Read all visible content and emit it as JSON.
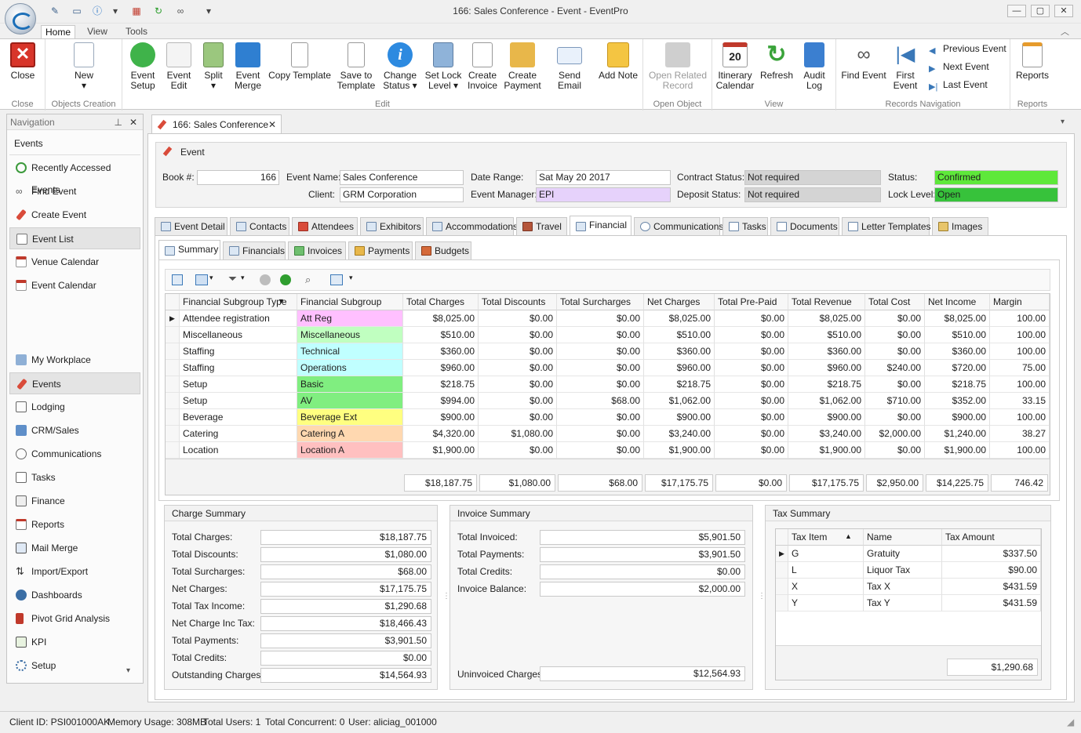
{
  "window": {
    "title": "166: Sales Conference - Event - EventPro"
  },
  "ribbon_tabs": [
    "Home",
    "View",
    "Tools"
  ],
  "ribbon": {
    "close": {
      "label": "Close",
      "group": "Close"
    },
    "objects_creation": {
      "group": "Objects Creation",
      "new_label": "New"
    },
    "edit_group": "Edit",
    "edit_buttons": [
      {
        "label1": "Event",
        "label2": "Setup"
      },
      {
        "label1": "Event",
        "label2": "Edit"
      },
      {
        "label1": "Split",
        "label2": "▾"
      },
      {
        "label1": "Event",
        "label2": "Merge"
      },
      {
        "label1": "Copy Template",
        "label2": ""
      },
      {
        "label1": "Save to",
        "label2": "Template"
      },
      {
        "label1": "Change",
        "label2": "Status ▾"
      },
      {
        "label1": "Set Lock",
        "label2": "Level ▾"
      },
      {
        "label1": "Create",
        "label2": "Invoice"
      },
      {
        "label1": "Create",
        "label2": "Payment"
      },
      {
        "label1": "Send Email",
        "label2": ""
      },
      {
        "label1": "Add Note",
        "label2": ""
      }
    ],
    "open_object": {
      "group": "Open Object",
      "label1": "Open Related",
      "label2": "Record"
    },
    "view_group": "View",
    "view_buttons": [
      {
        "label1": "Itinerary",
        "label2": "Calendar"
      },
      {
        "label1": "Refresh",
        "label2": ""
      },
      {
        "label1": "Audit",
        "label2": "Log"
      }
    ],
    "records_nav": {
      "group": "Records Navigation",
      "find_event": "Find Event",
      "first_event1": "First",
      "first_event2": "Event",
      "previous_event": "Previous Event",
      "next_event": "Next Event",
      "last_event": "Last Event"
    },
    "reports": {
      "group": "Reports",
      "label": "Reports"
    }
  },
  "navigation": {
    "header": "Navigation",
    "section": "Events",
    "top_items": [
      "Recently Accessed Events",
      "Find Event",
      "Create Event",
      "Event List",
      "Venue Calendar",
      "Event Calendar"
    ],
    "modules": [
      "My Workplace",
      "Events",
      "Lodging",
      "CRM/Sales",
      "Communications",
      "Tasks",
      "Finance",
      "Reports",
      "Mail Merge",
      "Import/Export",
      "Dashboards",
      "Pivot Grid Analysis",
      "KPI",
      "Setup"
    ]
  },
  "document_tab": "166: Sales Conference",
  "event": {
    "panel_title": "Event",
    "book_label": "Book #:",
    "book": "166",
    "name_label": "Event Name:",
    "name": "Sales Conference",
    "client_label": "Client:",
    "client": "GRM Corporation",
    "date_label": "Date Range:",
    "date": "Sat May 20 2017",
    "manager_label": "Event Manager:",
    "manager": "EPI",
    "contract_label": "Contract Status:",
    "contract": "Not required",
    "deposit_label": "Deposit Status:",
    "deposit": "Not required",
    "status_label": "Status:",
    "status": "Confirmed",
    "lock_label": "Lock Level:",
    "lock": "Open"
  },
  "main_tabs": [
    "Event Detail",
    "Contacts",
    "Attendees",
    "Exhibitors",
    "Accommodations",
    "Travel",
    "Financial",
    "Communications",
    "Tasks",
    "Documents",
    "Letter Templates",
    "Images"
  ],
  "sub_tabs": [
    "Summary",
    "Financials",
    "Invoices",
    "Payments",
    "Budgets"
  ],
  "grid": {
    "columns": [
      "Financial Subgroup Type",
      "Financial Subgroup",
      "Total Charges",
      "Total Discounts",
      "Total Surcharges",
      "Net Charges",
      "Total Pre-Paid",
      "Total Revenue",
      "Total Cost",
      "Net Income",
      "Margin"
    ],
    "rows": [
      {
        "type": "Attendee registration",
        "subgroup": "Att Reg",
        "color": "#ffc0ff",
        "charges": "$8,025.00",
        "discounts": "$0.00",
        "surcharges": "$0.00",
        "net": "$8,025.00",
        "prepaid": "$0.00",
        "revenue": "$8,025.00",
        "cost": "$0.00",
        "income": "$8,025.00",
        "margin": "100.00"
      },
      {
        "type": "Miscellaneous",
        "subgroup": "Miscellaneous",
        "color": "#c0ffc0",
        "charges": "$510.00",
        "discounts": "$0.00",
        "surcharges": "$0.00",
        "net": "$510.00",
        "prepaid": "$0.00",
        "revenue": "$510.00",
        "cost": "$0.00",
        "income": "$510.00",
        "margin": "100.00"
      },
      {
        "type": "Staffing",
        "subgroup": "Technical",
        "color": "#c0ffff",
        "charges": "$360.00",
        "discounts": "$0.00",
        "surcharges": "$0.00",
        "net": "$360.00",
        "prepaid": "$0.00",
        "revenue": "$360.00",
        "cost": "$0.00",
        "income": "$360.00",
        "margin": "100.00"
      },
      {
        "type": "Staffing",
        "subgroup": "Operations",
        "color": "#c0ffff",
        "charges": "$960.00",
        "discounts": "$0.00",
        "surcharges": "$0.00",
        "net": "$960.00",
        "prepaid": "$0.00",
        "revenue": "$960.00",
        "cost": "$240.00",
        "income": "$720.00",
        "margin": "75.00"
      },
      {
        "type": "Setup",
        "subgroup": "Basic",
        "color": "#80ee80",
        "charges": "$218.75",
        "discounts": "$0.00",
        "surcharges": "$0.00",
        "net": "$218.75",
        "prepaid": "$0.00",
        "revenue": "$218.75",
        "cost": "$0.00",
        "income": "$218.75",
        "margin": "100.00"
      },
      {
        "type": "Setup",
        "subgroup": "AV",
        "color": "#80ee80",
        "charges": "$994.00",
        "discounts": "$0.00",
        "surcharges": "$68.00",
        "net": "$1,062.00",
        "prepaid": "$0.00",
        "revenue": "$1,062.00",
        "cost": "$710.00",
        "income": "$352.00",
        "margin": "33.15"
      },
      {
        "type": "Beverage",
        "subgroup": "Beverage Ext",
        "color": "#ffff80",
        "charges": "$900.00",
        "discounts": "$0.00",
        "surcharges": "$0.00",
        "net": "$900.00",
        "prepaid": "$0.00",
        "revenue": "$900.00",
        "cost": "$0.00",
        "income": "$900.00",
        "margin": "100.00"
      },
      {
        "type": "Catering",
        "subgroup": "Catering A",
        "color": "#ffd8b0",
        "charges": "$4,320.00",
        "discounts": "$1,080.00",
        "surcharges": "$0.00",
        "net": "$3,240.00",
        "prepaid": "$0.00",
        "revenue": "$3,240.00",
        "cost": "$2,000.00",
        "income": "$1,240.00",
        "margin": "38.27"
      },
      {
        "type": "Location",
        "subgroup": "Location A",
        "color": "#ffc0c0",
        "charges": "$1,900.00",
        "discounts": "$0.00",
        "surcharges": "$0.00",
        "net": "$1,900.00",
        "prepaid": "$0.00",
        "revenue": "$1,900.00",
        "cost": "$0.00",
        "income": "$1,900.00",
        "margin": "100.00"
      }
    ],
    "totals": [
      "$18,187.75",
      "$1,080.00",
      "$68.00",
      "$17,175.75",
      "$0.00",
      "$17,175.75",
      "$2,950.00",
      "$14,225.75",
      "746.42"
    ]
  },
  "charge_summary": {
    "title": "Charge Summary",
    "rows": [
      {
        "label": "Total Charges:",
        "value": "$18,187.75"
      },
      {
        "label": "Total Discounts:",
        "value": "$1,080.00"
      },
      {
        "label": "Total Surcharges:",
        "value": "$68.00"
      },
      {
        "label": "Net Charges:",
        "value": "$17,175.75"
      },
      {
        "label": "Total Tax Income:",
        "value": "$1,290.68"
      },
      {
        "label": "Net Charge Inc Tax:",
        "value": "$18,466.43"
      },
      {
        "label": "Total Payments:",
        "value": "$3,901.50"
      },
      {
        "label": "Total Credits:",
        "value": "$0.00"
      },
      {
        "label": "Outstanding Charges:",
        "value": "$14,564.93"
      }
    ]
  },
  "invoice_summary": {
    "title": "Invoice Summary",
    "rows": [
      {
        "label": "Total Invoiced:",
        "value": "$5,901.50"
      },
      {
        "label": "Total Payments:",
        "value": "$3,901.50"
      },
      {
        "label": "Total Credits:",
        "value": "$0.00"
      },
      {
        "label": "Invoice Balance:",
        "value": "$2,000.00"
      }
    ],
    "uninvoiced_label": "Uninvoiced Charges:",
    "uninvoiced_value": "$12,564.93"
  },
  "tax_summary": {
    "title": "Tax Summary",
    "columns": [
      "Tax Item",
      "Name",
      "Tax Amount"
    ],
    "rows": [
      {
        "item": "G",
        "name": "Gratuity",
        "amount": "$337.50"
      },
      {
        "item": "L",
        "name": "Liquor Tax",
        "amount": "$90.00"
      },
      {
        "item": "X",
        "name": "Tax X",
        "amount": "$431.59"
      },
      {
        "item": "Y",
        "name": "Tax Y",
        "amount": "$431.59"
      }
    ],
    "total": "$1,290.68"
  },
  "statusbar": {
    "client_id": "Client ID: PSI001000AK",
    "memory": "Memory Usage: 308MB",
    "users": "Total Users: 1",
    "concurrent": "Total Concurrent: 0",
    "user": "User: aliciag_001000"
  },
  "colors": {
    "status_green": "#5ee83a",
    "manager_purple": "#e6d2fb",
    "readonly_gray": "#d4d4d4"
  }
}
